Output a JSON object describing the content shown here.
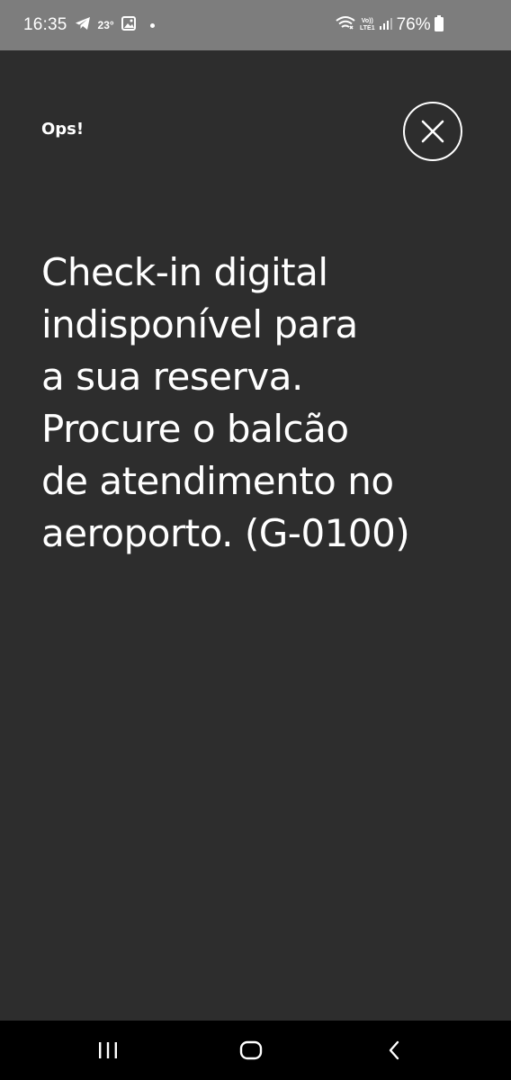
{
  "status_bar": {
    "time": "16:35",
    "temperature": "23°",
    "battery_percent": "76%",
    "network_label_top": "Vo))",
    "network_label_bottom": "LTE1",
    "icons": [
      "telegram-icon",
      "gallery-icon",
      "notification-dot-icon",
      "wifi-icon",
      "signal-icon",
      "battery-icon"
    ]
  },
  "dialog": {
    "title": "Ops!",
    "close_icon": "close-icon",
    "message_lines": [
      "Check-in digital",
      "indisponível para",
      "a sua reserva.",
      "Procure o balcão",
      "de atendimento no",
      "aeroporto. (G-0100)"
    ]
  },
  "nav_bar": {
    "icons": [
      "recent-apps-icon",
      "home-icon",
      "back-icon"
    ]
  },
  "colors": {
    "background": "#2d2d2d",
    "status_bar": "#7d7d7d",
    "nav_bar": "#000000",
    "text": "#ffffff"
  }
}
